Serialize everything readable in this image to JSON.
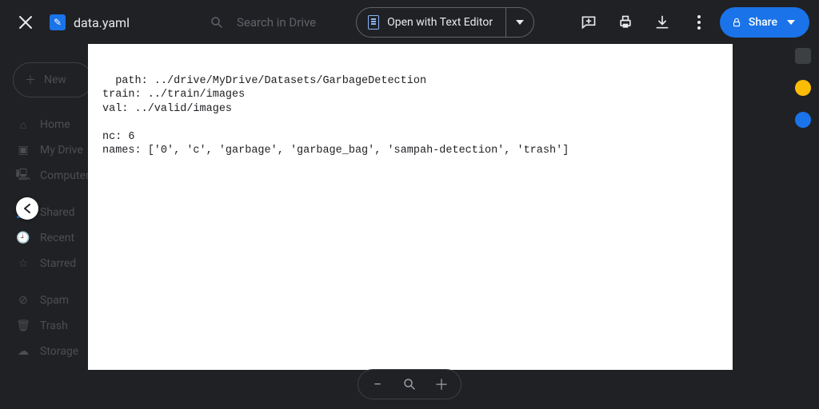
{
  "header": {
    "filename": "data.yaml",
    "search_placeholder": "Search in Drive",
    "open_with_label": "Open with Text Editor",
    "share_label": "Share"
  },
  "sidenav": {
    "new_label": "New",
    "items_a": [
      "Home",
      "My Drive",
      "Computers"
    ],
    "items_b": [
      "Shared",
      "Recent",
      "Starred"
    ],
    "items_c": [
      "Spam",
      "Trash",
      "Storage"
    ]
  },
  "file_content": "path: ../drive/MyDrive/Datasets/GarbageDetection\ntrain: ../train/images\nval: ../valid/images\n\nnc: 6\nnames: ['0', 'c', 'garbage', 'garbage_bag', 'sampah-detection', 'trash']"
}
